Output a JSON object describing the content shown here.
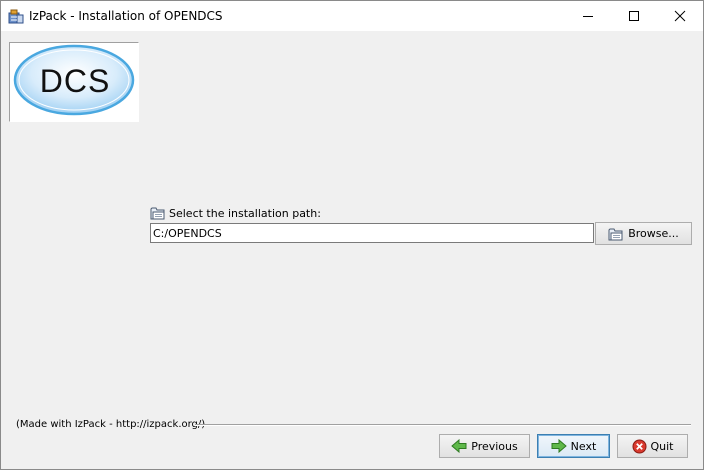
{
  "window": {
    "title": "IzPack - Installation of OPENDCS",
    "icon": "izpack-app-icon",
    "controls": {
      "minimize_icon": "minimize-icon",
      "maximize_icon": "maximize-icon",
      "close_icon": "close-icon"
    }
  },
  "logo": {
    "text": "DCS",
    "fill_color": "#cfe8fb",
    "stroke_color": "#4aa8e0"
  },
  "path_section": {
    "label": "Select the installation path:",
    "label_icon": "folder-icon",
    "value": "C:/OPENDCS",
    "browse_label": "Browse...",
    "browse_icon": "folder-icon"
  },
  "footer": {
    "made_with": "(Made with IzPack - http://izpack.org/)"
  },
  "nav": {
    "previous_label": "Previous",
    "previous_icon": "arrow-left-icon",
    "next_label": "Next",
    "next_icon": "arrow-right-icon",
    "quit_label": "Quit",
    "quit_icon": "quit-icon",
    "accent_color": "#3c7fb1"
  }
}
